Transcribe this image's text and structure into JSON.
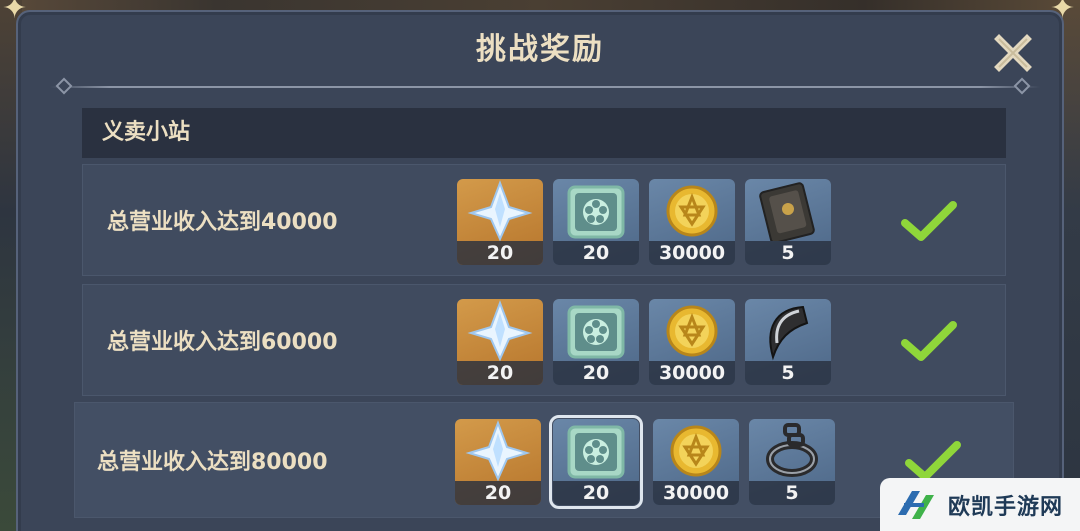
{
  "dialog": {
    "title": "挑战奖励",
    "close_icon": "close-icon"
  },
  "section": {
    "title": "义卖小站"
  },
  "colors": {
    "panel": "#3b4558",
    "header": "#2a3140",
    "text": "#ecdfc2",
    "check": "#8fd63a"
  },
  "rows": [
    {
      "label": "总营业收入达到40000",
      "completed": true,
      "rewards": [
        {
          "icon": "primogem-icon",
          "count": "20"
        },
        {
          "icon": "event-token-icon",
          "count": "20"
        },
        {
          "icon": "mora-icon",
          "count": "30000"
        },
        {
          "icon": "mystic-book-icon",
          "count": "5"
        }
      ]
    },
    {
      "label": "总营业收入达到60000",
      "completed": true,
      "rewards": [
        {
          "icon": "primogem-icon",
          "count": "20"
        },
        {
          "icon": "event-token-icon",
          "count": "20"
        },
        {
          "icon": "mora-icon",
          "count": "30000"
        },
        {
          "icon": "horn-material-icon",
          "count": "5"
        }
      ]
    },
    {
      "label": "总营业收入达到80000",
      "completed": true,
      "rewards": [
        {
          "icon": "primogem-icon",
          "count": "20"
        },
        {
          "icon": "event-token-icon",
          "count": "20"
        },
        {
          "icon": "mora-icon",
          "count": "30000"
        },
        {
          "icon": "chain-material-icon",
          "count": "5"
        }
      ]
    }
  ],
  "watermark": {
    "text": "欧凯手游网"
  }
}
